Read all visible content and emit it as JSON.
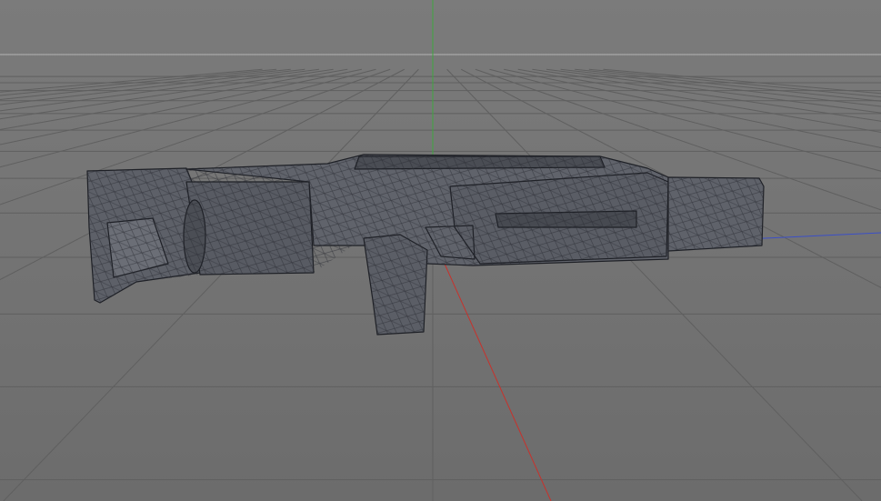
{
  "viewport": {
    "mode": "perspective",
    "colors": {
      "background_top": "#7b7b7b",
      "background_bottom": "#6c6c6c",
      "grid": "#5f5f5f",
      "horizon": "#b4b4b4",
      "axis_x": "#c8312b",
      "axis_y": "#3fa63f",
      "axis_z": "#3b4fc7",
      "mesh_fill": "#5e6169",
      "mesh_wire": "#1e2026"
    }
  }
}
